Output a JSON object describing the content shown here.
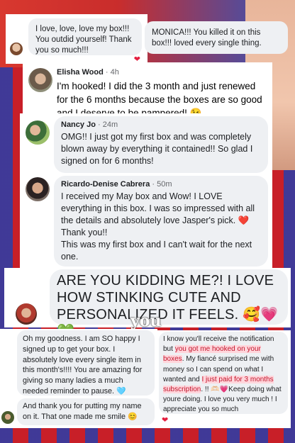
{
  "comments": {
    "c1": {
      "text": "I love, love, love my box!!! You outdid yourself!  Thank you so much!!!"
    },
    "c2": {
      "text": "MONICA!!! You killed it on this box!!! loved every single thing."
    },
    "c3": {
      "name": "Elisha Wood",
      "time": "4h",
      "text": "I'm hooked! I did the 3 month and just renewed for the 6 months because the boxes are so good and I deserve to be pampered! 😉"
    },
    "c4": {
      "name": "Nancy Jo",
      "time": "24m",
      "text": "OMG!!  I just got my first box and was completely blown away by everything it contained!!  So glad I signed on for 6 months!"
    },
    "c5": {
      "name": "Ricardo-Denise Cabrera",
      "time": "50m",
      "text1": "I received my May box and Wow! I LOVE everything in this box. I was so impressed with all the details and absolutely love Jasper's pick. ❤️",
      "text2": "Thank you!!",
      "text3": "This was my first box and I can't wait for the next one."
    },
    "c6": {
      "text": "ARE YOU KIDDING ME?! I LOVE HOW STINKING CUTE AND PERSONALIZED IT FEELS. 🥰💗💚"
    },
    "c7": {
      "text1": "Oh my goodness. I am SO happy I signed up to get your box. I absolutely love every single item in this month's!!!! You are amazing for giving so many ladies a much needed reminder to pause. 🩵",
      "text2": "And thank you for putting my name on it. That one made me smile 😊"
    },
    "c8": {
      "part1": "I know you'll receive the notification but ",
      "hl1": "you got me hooked on your boxes",
      "part2": ". My fiancé surprised me with money so I can spend on what I wanted and ",
      "hl2": "I just paid for 3 months subscription",
      "part3": ". !! 🫶🏻💗Keep doing what youre doing. I love you very much ! I appreciate you so much"
    }
  },
  "overlay_word": "you",
  "colors": {
    "bubble": "#eef0f3",
    "heart": "#e41e3f",
    "highlight": "#ffd6dc"
  }
}
